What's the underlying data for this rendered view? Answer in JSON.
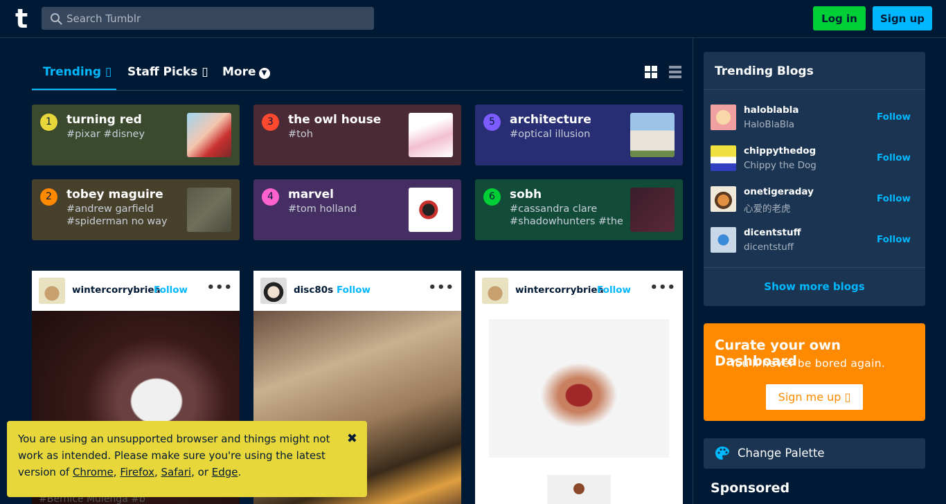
{
  "header": {
    "logo": "t",
    "search_placeholder": "Search Tumblr",
    "login_label": "Log in",
    "signup_label": "Sign up"
  },
  "tabs": {
    "trending": "Trending ▯",
    "staff_picks": "Staff Picks ▯",
    "more": "More"
  },
  "trending": [
    {
      "num": "1",
      "title": "turning red",
      "tags": "#pixar #disney",
      "bg": "#3b4a2e",
      "num_color": "#e8d73a"
    },
    {
      "num": "2",
      "title": "tobey maguire",
      "tags": "#andrew garfield #spiderman no way",
      "bg": "#47402a",
      "num_color": "#ff8a00"
    },
    {
      "num": "3",
      "title": "the owl house",
      "tags": "#toh",
      "bg": "#4a2a35",
      "num_color": "#ff492f"
    },
    {
      "num": "4",
      "title": "marvel",
      "tags": "#tom holland",
      "bg": "#452e62",
      "num_color": "#ff62ce"
    },
    {
      "num": "5",
      "title": "architecture",
      "tags": "#optical illusion",
      "bg": "#282e73",
      "num_color": "#7c5cff"
    },
    {
      "num": "6",
      "title": "sobh",
      "tags": "#cassandra clare #shadowhunters #the",
      "bg": "#124c39",
      "num_color": "#00cf35"
    }
  ],
  "posts": [
    {
      "user": "wintercorrybriea",
      "follow": "Follow",
      "caption": "#Bernice Mulenga   #b"
    },
    {
      "user": "disc80s",
      "follow": "Follow"
    },
    {
      "user": "wintercorrybriea",
      "follow": "Follow"
    }
  ],
  "banner": {
    "text1": "You are using an unsupported browser and things might not work as intended. Please make sure you're using the latest version of ",
    "chrome": "Chrome",
    "sep1": ", ",
    "firefox": "Firefox",
    "sep2": ", ",
    "safari": "Safari",
    "sep3": ", or ",
    "edge": "Edge",
    "end": ".",
    "close": "✖"
  },
  "sidebar": {
    "trending_blogs_title": "Trending Blogs",
    "blogs": [
      {
        "name": "haloblabla",
        "sub": "HaloBlaBla",
        "follow": "Follow"
      },
      {
        "name": "chippythedog",
        "sub": "Chippy the Dog",
        "follow": "Follow"
      },
      {
        "name": "onetigeraday",
        "sub": "心爱的老虎",
        "follow": "Follow"
      },
      {
        "name": "dicentstuff",
        "sub": "dicentstuff",
        "follow": "Follow"
      }
    ],
    "show_more": "Show more blogs",
    "curate_title": "Curate your own Dashboard",
    "curate_sub": "You'll never be bored again.",
    "curate_button": "Sign me up ▯",
    "palette_label": "Change Palette",
    "sponsored": "Sponsored"
  }
}
